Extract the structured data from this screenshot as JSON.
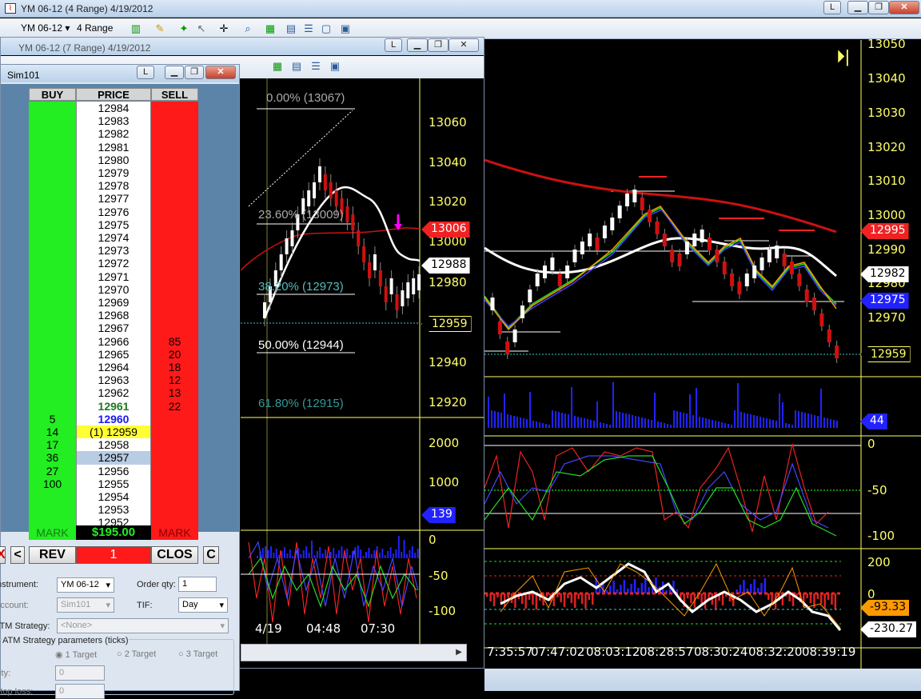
{
  "main_window": {
    "title": "YM 06-12 (4 Range)  4/19/2012",
    "btn_l": "L"
  },
  "toolbar": {
    "instrument": "YM 06-12",
    "period": "4 Range"
  },
  "main_chart": {
    "price_labels": [
      "13050",
      "13040",
      "13030",
      "13020",
      "13010",
      "13000",
      "12990",
      "12980",
      "12970"
    ],
    "tags": {
      "red": "12995",
      "white": "12982",
      "blue": "12975",
      "last": "12959"
    },
    "volume_tag": "44",
    "osc1_labels": [
      "0",
      "-50",
      "-100"
    ],
    "osc2_labels": [
      "200",
      "0"
    ],
    "osc2_tags": {
      "orange": "-93.33",
      "white": "-230.27"
    },
    "time_labels": [
      "7:35:57",
      "07:47:02",
      "08:03:12",
      "08:28:57",
      "08:30:24",
      "08:32:20",
      "08:39:19"
    ],
    "colors": {
      "sma": "#cc1111",
      "ema": "#ffffff",
      "up": "#ffffff",
      "down": "#d01010"
    }
  },
  "second_window": {
    "title": "YM 06-12 (7 Range)  4/19/2012",
    "btn_l": "L",
    "fib_levels": [
      "0.00% (13067)",
      "23.60% (13009)",
      "38.20% (12973)",
      "50.00% (12944)",
      "61.80% (12915)"
    ],
    "price_labels": [
      "13060",
      "13040",
      "13020",
      "13000",
      "12980",
      "12940",
      "12920"
    ],
    "tags": {
      "red": "13006",
      "white": "12988",
      "last": "12959"
    },
    "volume_labels": [
      "2000",
      "1000"
    ],
    "volume_tag": "139",
    "osc_labels": [
      "0",
      "-50",
      "-100"
    ],
    "time_labels": [
      "4/19",
      "04:48",
      "07:30"
    ]
  },
  "dom": {
    "title": "Sim101",
    "btn_l": "L",
    "headers": {
      "buy": "BUY",
      "price": "PRICE",
      "sell": "SELL"
    },
    "rows": [
      {
        "price": "12984",
        "buy": "",
        "sell": ""
      },
      {
        "price": "12983",
        "buy": "",
        "sell": ""
      },
      {
        "price": "12982",
        "buy": "",
        "sell": ""
      },
      {
        "price": "12981",
        "buy": "",
        "sell": ""
      },
      {
        "price": "12980",
        "buy": "",
        "sell": ""
      },
      {
        "price": "12979",
        "buy": "",
        "sell": ""
      },
      {
        "price": "12978",
        "buy": "",
        "sell": ""
      },
      {
        "price": "12977",
        "buy": "",
        "sell": ""
      },
      {
        "price": "12976",
        "buy": "",
        "sell": ""
      },
      {
        "price": "12975",
        "buy": "",
        "sell": ""
      },
      {
        "price": "12974",
        "buy": "",
        "sell": ""
      },
      {
        "price": "12973",
        "buy": "",
        "sell": ""
      },
      {
        "price": "12972",
        "buy": "",
        "sell": ""
      },
      {
        "price": "12971",
        "buy": "",
        "sell": ""
      },
      {
        "price": "12970",
        "buy": "",
        "sell": ""
      },
      {
        "price": "12969",
        "buy": "",
        "sell": ""
      },
      {
        "price": "12968",
        "buy": "",
        "sell": ""
      },
      {
        "price": "12967",
        "buy": "",
        "sell": ""
      },
      {
        "price": "12966",
        "buy": "",
        "sell": "85"
      },
      {
        "price": "12965",
        "buy": "",
        "sell": "20"
      },
      {
        "price": "12964",
        "buy": "",
        "sell": "18"
      },
      {
        "price": "12963",
        "buy": "",
        "sell": "12"
      },
      {
        "price": "12962",
        "buy": "",
        "sell": "13"
      },
      {
        "price": "12961",
        "buy": "",
        "sell": "22"
      },
      {
        "price": "12960",
        "buy": "5",
        "sell": ""
      },
      {
        "price": "(1) 12959",
        "buy": "14",
        "sell": ""
      },
      {
        "price": "12958",
        "buy": "17",
        "sell": ""
      },
      {
        "price": "12957",
        "buy": "36",
        "sell": ""
      },
      {
        "price": "12956",
        "buy": "27",
        "sell": ""
      },
      {
        "price": "12955",
        "buy": "100",
        "sell": ""
      },
      {
        "price": "12954",
        "buy": "",
        "sell": ""
      },
      {
        "price": "12953",
        "buy": "",
        "sell": ""
      },
      {
        "price": "12952",
        "buy": "",
        "sell": ""
      }
    ],
    "mark_left": "MARK",
    "pnl": "$195.00",
    "mark_right": "MARK",
    "buttons": {
      "x": "X",
      "lt": "<",
      "rev": "REV",
      "qty": "1",
      "close": "CLOS",
      "c": "C"
    },
    "form": {
      "instrument_label": "Instrument:",
      "instrument": "YM 06-12",
      "orderqty_label": "Order qty:",
      "orderqty": "1",
      "account_label": "Account:",
      "account": "Sim101",
      "tif_label": "TIF:",
      "tif": "Day",
      "atm_label": "ATM Strategy:",
      "atm": "<None>",
      "atm_params": "ATM Strategy parameters (ticks)",
      "t1": "1 Target",
      "t2": "2 Target",
      "t3": "3 Target",
      "qty_label": "Qty:",
      "qty": "0",
      "stop_label": "Stop loss:",
      "stop": "0"
    }
  }
}
